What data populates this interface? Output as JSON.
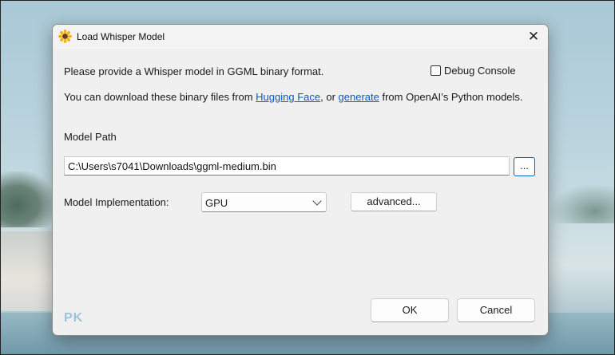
{
  "dialog": {
    "title": "Load Whisper Model",
    "close_glyph": "✕",
    "intro_text": "Please provide a Whisper model in GGML binary format.",
    "debug_console_label": "Debug Console",
    "debug_console_checked": false,
    "download_text_prefix": "You can download these binary files from ",
    "link_hugging_face": "Hugging Face",
    "download_text_middle": ", or ",
    "link_generate": "generate",
    "download_text_suffix": " from OpenAI’s Python models.",
    "model_path_label": "Model Path",
    "model_path_value": "C:\\Users\\s7041\\Downloads\\ggml-medium.bin",
    "browse_label": "...",
    "implementation_label": "Model Implementation:",
    "implementation_value": "GPU",
    "advanced_label": "advanced...",
    "ok_label": "OK",
    "cancel_label": "Cancel"
  },
  "watermark": "PK",
  "icons": {
    "app": "sunflower-icon",
    "close": "close-icon",
    "dropdown": "chevron-down-icon"
  },
  "colors": {
    "link": "#0b57d0",
    "focus_border": "#0067c0",
    "dialog_bg": "#f0f0f0"
  }
}
